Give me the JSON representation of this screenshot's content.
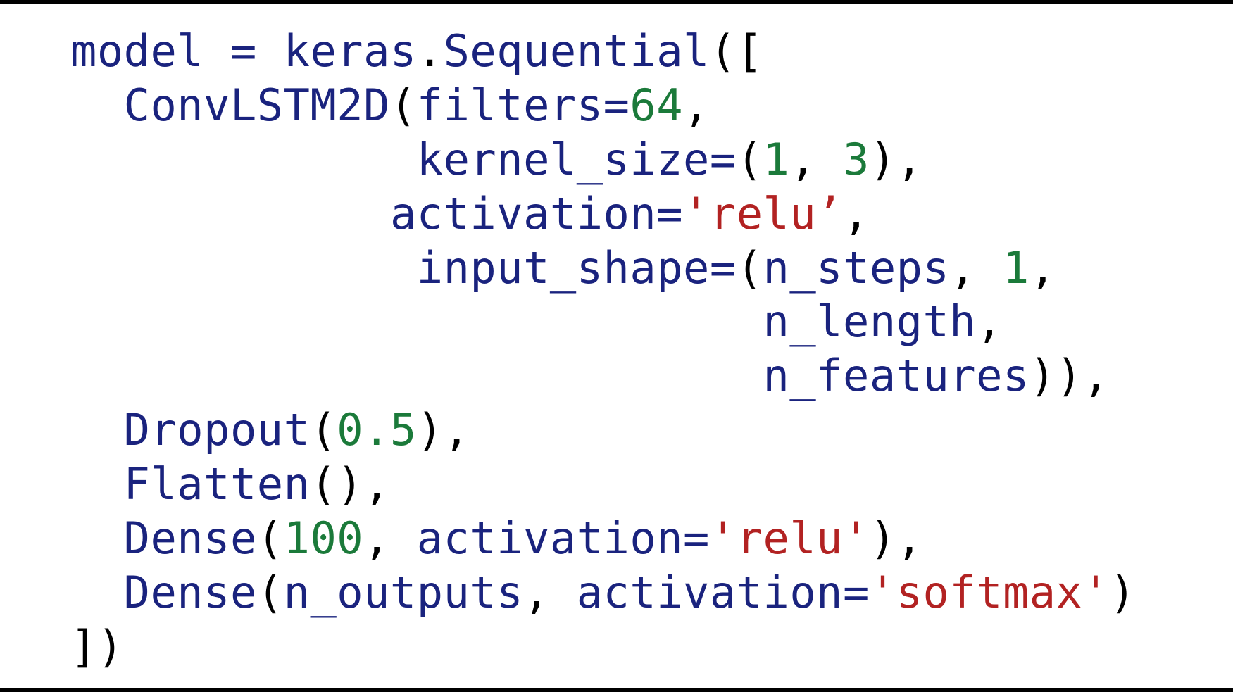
{
  "colors": {
    "identifier": "#1a237e",
    "number": "#1b7a3a",
    "string": "#b22222",
    "plain": "#000000",
    "background": "#ffffff",
    "border": "#000000"
  },
  "code": {
    "lines": [
      [
        {
          "t": "var",
          "v": "model"
        },
        {
          "t": "plain",
          "v": " "
        },
        {
          "t": "var",
          "v": "="
        },
        {
          "t": "plain",
          "v": " "
        },
        {
          "t": "var",
          "v": "keras"
        },
        {
          "t": "plain",
          "v": "."
        },
        {
          "t": "var",
          "v": "Sequential"
        },
        {
          "t": "plain",
          "v": "(["
        }
      ],
      [
        {
          "t": "plain",
          "v": "  "
        },
        {
          "t": "var",
          "v": "ConvLSTM2D"
        },
        {
          "t": "plain",
          "v": "("
        },
        {
          "t": "var",
          "v": "filters"
        },
        {
          "t": "var",
          "v": "="
        },
        {
          "t": "num",
          "v": "64"
        },
        {
          "t": "plain",
          "v": ","
        }
      ],
      [
        {
          "t": "plain",
          "v": "             "
        },
        {
          "t": "var",
          "v": "kernel_size"
        },
        {
          "t": "var",
          "v": "="
        },
        {
          "t": "plain",
          "v": "("
        },
        {
          "t": "num",
          "v": "1"
        },
        {
          "t": "plain",
          "v": ", "
        },
        {
          "t": "num",
          "v": "3"
        },
        {
          "t": "plain",
          "v": "),"
        }
      ],
      [
        {
          "t": "plain",
          "v": "            "
        },
        {
          "t": "var",
          "v": "activation"
        },
        {
          "t": "var",
          "v": "="
        },
        {
          "t": "str",
          "v": "'relu’"
        },
        {
          "t": "plain",
          "v": ","
        }
      ],
      [
        {
          "t": "plain",
          "v": "             "
        },
        {
          "t": "var",
          "v": "input_shape"
        },
        {
          "t": "var",
          "v": "="
        },
        {
          "t": "plain",
          "v": "("
        },
        {
          "t": "var",
          "v": "n_steps"
        },
        {
          "t": "plain",
          "v": ", "
        },
        {
          "t": "num",
          "v": "1"
        },
        {
          "t": "plain",
          "v": ","
        }
      ],
      [
        {
          "t": "plain",
          "v": "                          "
        },
        {
          "t": "var",
          "v": "n_length"
        },
        {
          "t": "plain",
          "v": ","
        }
      ],
      [
        {
          "t": "plain",
          "v": "                          "
        },
        {
          "t": "var",
          "v": "n_features"
        },
        {
          "t": "plain",
          "v": ")),"
        }
      ],
      [
        {
          "t": "plain",
          "v": "  "
        },
        {
          "t": "var",
          "v": "Dropout"
        },
        {
          "t": "plain",
          "v": "("
        },
        {
          "t": "num",
          "v": "0.5"
        },
        {
          "t": "plain",
          "v": "),"
        }
      ],
      [
        {
          "t": "plain",
          "v": "  "
        },
        {
          "t": "var",
          "v": "Flatten"
        },
        {
          "t": "plain",
          "v": "(),"
        }
      ],
      [
        {
          "t": "plain",
          "v": "  "
        },
        {
          "t": "var",
          "v": "Dense"
        },
        {
          "t": "plain",
          "v": "("
        },
        {
          "t": "num",
          "v": "100"
        },
        {
          "t": "plain",
          "v": ", "
        },
        {
          "t": "var",
          "v": "activation"
        },
        {
          "t": "var",
          "v": "="
        },
        {
          "t": "str",
          "v": "'relu'"
        },
        {
          "t": "plain",
          "v": "),"
        }
      ],
      [
        {
          "t": "plain",
          "v": "  "
        },
        {
          "t": "var",
          "v": "Dense"
        },
        {
          "t": "plain",
          "v": "("
        },
        {
          "t": "var",
          "v": "n_outputs"
        },
        {
          "t": "plain",
          "v": ", "
        },
        {
          "t": "var",
          "v": "activation"
        },
        {
          "t": "var",
          "v": "="
        },
        {
          "t": "str",
          "v": "'softmax'"
        },
        {
          "t": "plain",
          "v": ")"
        }
      ],
      [
        {
          "t": "plain",
          "v": "])"
        }
      ]
    ]
  }
}
